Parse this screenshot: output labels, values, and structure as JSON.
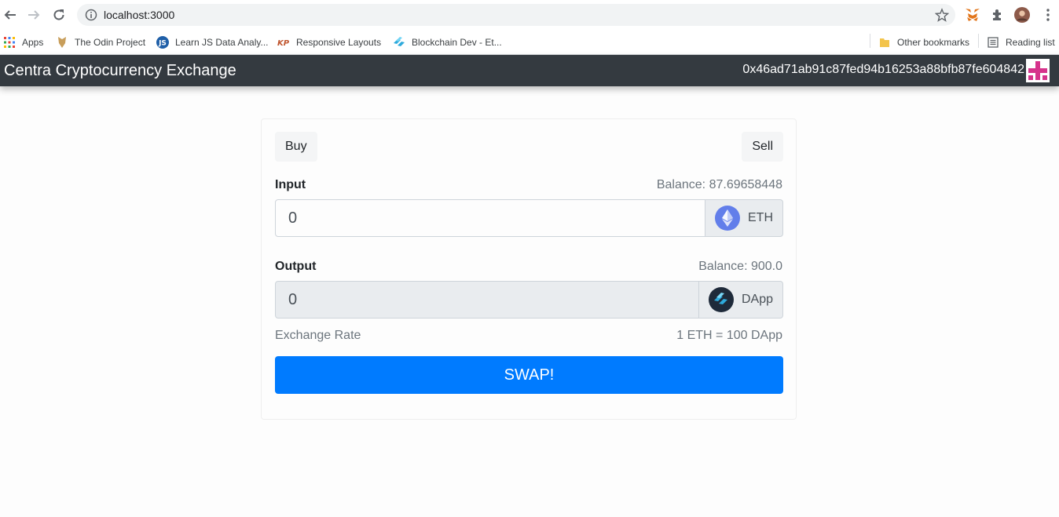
{
  "browser": {
    "url": "localhost:3000",
    "bookmarks": [
      {
        "label": "Apps",
        "icon": "apps-grid-icon"
      },
      {
        "label": "The Odin Project",
        "icon": "odin-project-icon"
      },
      {
        "label": "Learn JS Data Analy...",
        "icon": "js-icon"
      },
      {
        "label": "Responsive Layouts",
        "icon": "kp-icon"
      },
      {
        "label": "Blockchain Dev - Et...",
        "icon": "blockchain-icon"
      }
    ],
    "other_bookmarks": "Other bookmarks",
    "reading_list": "Reading list"
  },
  "navbar": {
    "brand": "Centra Cryptocurrency Exchange",
    "account": "0x46ad71ab91c87fed94b16253a88bfb87fe604842"
  },
  "exchange": {
    "buy_label": "Buy",
    "sell_label": "Sell",
    "input_label": "Input",
    "input_balance": "Balance: 87.69658448",
    "input_value": "0",
    "input_token": "ETH",
    "output_label": "Output",
    "output_balance": "Balance: 900.0",
    "output_value": "0",
    "output_token": "DApp",
    "rate_label": "Exchange Rate",
    "rate_value": "1 ETH = 100 DApp",
    "swap_label": "SWAP!"
  },
  "colors": {
    "navbar": "#343a40",
    "primary": "#007bff",
    "eth": "#627eea",
    "identicon": "#d6338c"
  }
}
